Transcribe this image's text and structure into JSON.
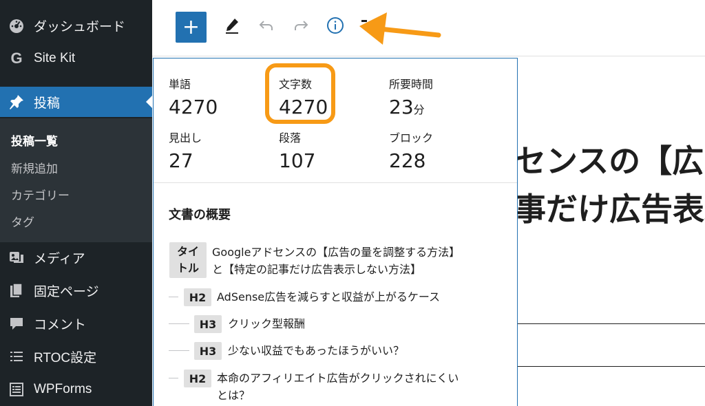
{
  "sidebar": {
    "items": [
      {
        "label": "ダッシュボード",
        "icon": "dashboard-icon"
      },
      {
        "label": "Site Kit",
        "icon": "google-g-icon"
      },
      {
        "label": "投稿",
        "icon": "pin-icon"
      },
      {
        "label": "メディア",
        "icon": "media-icon"
      },
      {
        "label": "固定ページ",
        "icon": "page-icon"
      },
      {
        "label": "コメント",
        "icon": "comment-icon"
      },
      {
        "label": "RTOC設定",
        "icon": "list-icon"
      },
      {
        "label": "WPForms",
        "icon": "form-icon"
      }
    ],
    "submenu": [
      "投稿一覧",
      "新規追加",
      "カテゴリー",
      "タグ"
    ]
  },
  "toolbar": {
    "add": "+",
    "icons": [
      "plus-icon",
      "pencil-icon",
      "undo-icon",
      "redo-icon",
      "info-icon"
    ]
  },
  "stats": [
    {
      "label": "単語",
      "value": "4270",
      "unit": ""
    },
    {
      "label": "文字数",
      "value": "4270",
      "unit": ""
    },
    {
      "label": "所要時間",
      "value": "23",
      "unit": "分"
    },
    {
      "label": "見出し",
      "value": "27",
      "unit": ""
    },
    {
      "label": "段落",
      "value": "107",
      "unit": ""
    },
    {
      "label": "ブロック",
      "value": "228",
      "unit": ""
    }
  ],
  "outline": {
    "heading": "文書の概要",
    "title_badge_line1": "タイ",
    "title_badge_line2": "トル",
    "title_text_line1": "Googleアドセンスの【広告の量を調整する方法】",
    "title_text_line2": "と【特定の記事だけ広告表示しない方法】",
    "items": [
      {
        "level": "H2",
        "text": "AdSense広告を減らすと収益が上がるケース"
      },
      {
        "level": "H3",
        "text": "クリック型報酬"
      },
      {
        "level": "H3",
        "text": "少ない収益でもあったほうがいい？"
      },
      {
        "level": "H2",
        "text": "本命のアフィリエイト広告がクリックされにくい",
        "text2": "とは？"
      }
    ]
  },
  "editor_title": {
    "line1": "センスの【広",
    "line2": "事だけ広告表示"
  },
  "colors": {
    "sidebar_bg": "#1d2327",
    "submenu_bg": "#2c3338",
    "accent": "#2271b1",
    "annotation": "#f79a16"
  }
}
